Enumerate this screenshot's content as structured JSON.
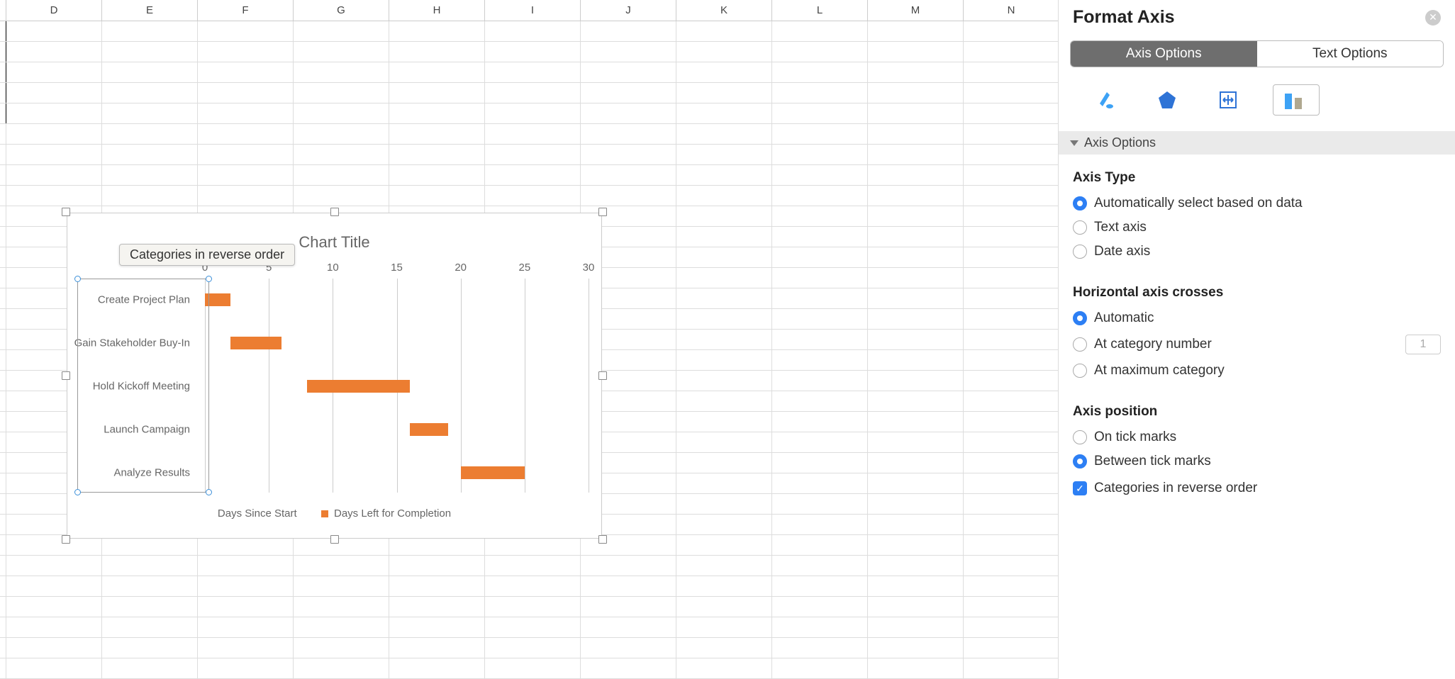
{
  "grid": {
    "columns": [
      "D",
      "E",
      "F",
      "G",
      "H",
      "I",
      "J",
      "K",
      "L",
      "M",
      "N"
    ]
  },
  "tooltip": "Categories in reverse order",
  "chart_data": {
    "type": "bar",
    "title": "Chart Title",
    "xlabel": "",
    "ylabel": "",
    "xlim": [
      0,
      30
    ],
    "ticks": [
      0,
      5,
      10,
      15,
      20,
      25,
      30
    ],
    "categories": [
      "Create Project Plan",
      "Gain Stakeholder Buy-In",
      "Hold Kickoff Meeting",
      "Launch Campaign",
      "Analyze Results"
    ],
    "series": [
      {
        "name": "Days Since Start",
        "values": [
          0,
          2,
          8,
          16,
          20
        ],
        "visible": false
      },
      {
        "name": "Days Left for Completion",
        "values": [
          2,
          4,
          8,
          3,
          5
        ],
        "visible": true,
        "color": "#ec7d31"
      }
    ],
    "legend": [
      "Days Since Start",
      "Days Left for Completion"
    ]
  },
  "sidebar": {
    "title": "Format Axis",
    "seg_options": [
      "Axis Options",
      "Text Options"
    ],
    "seg_active": 0,
    "section_label": "Axis Options",
    "axis_type": {
      "heading": "Axis Type",
      "options": [
        "Automatically select based on data",
        "Text axis",
        "Date axis"
      ],
      "selected": 0
    },
    "crosses": {
      "heading": "Horizontal axis crosses",
      "options": [
        "Automatic",
        "At category number",
        "At maximum category"
      ],
      "selected": 0,
      "cat_number": "1"
    },
    "position": {
      "heading": "Axis position",
      "options": [
        "On tick marks",
        "Between tick marks"
      ],
      "selected": 1,
      "reverse_label": "Categories in reverse order",
      "reverse_checked": true
    }
  }
}
